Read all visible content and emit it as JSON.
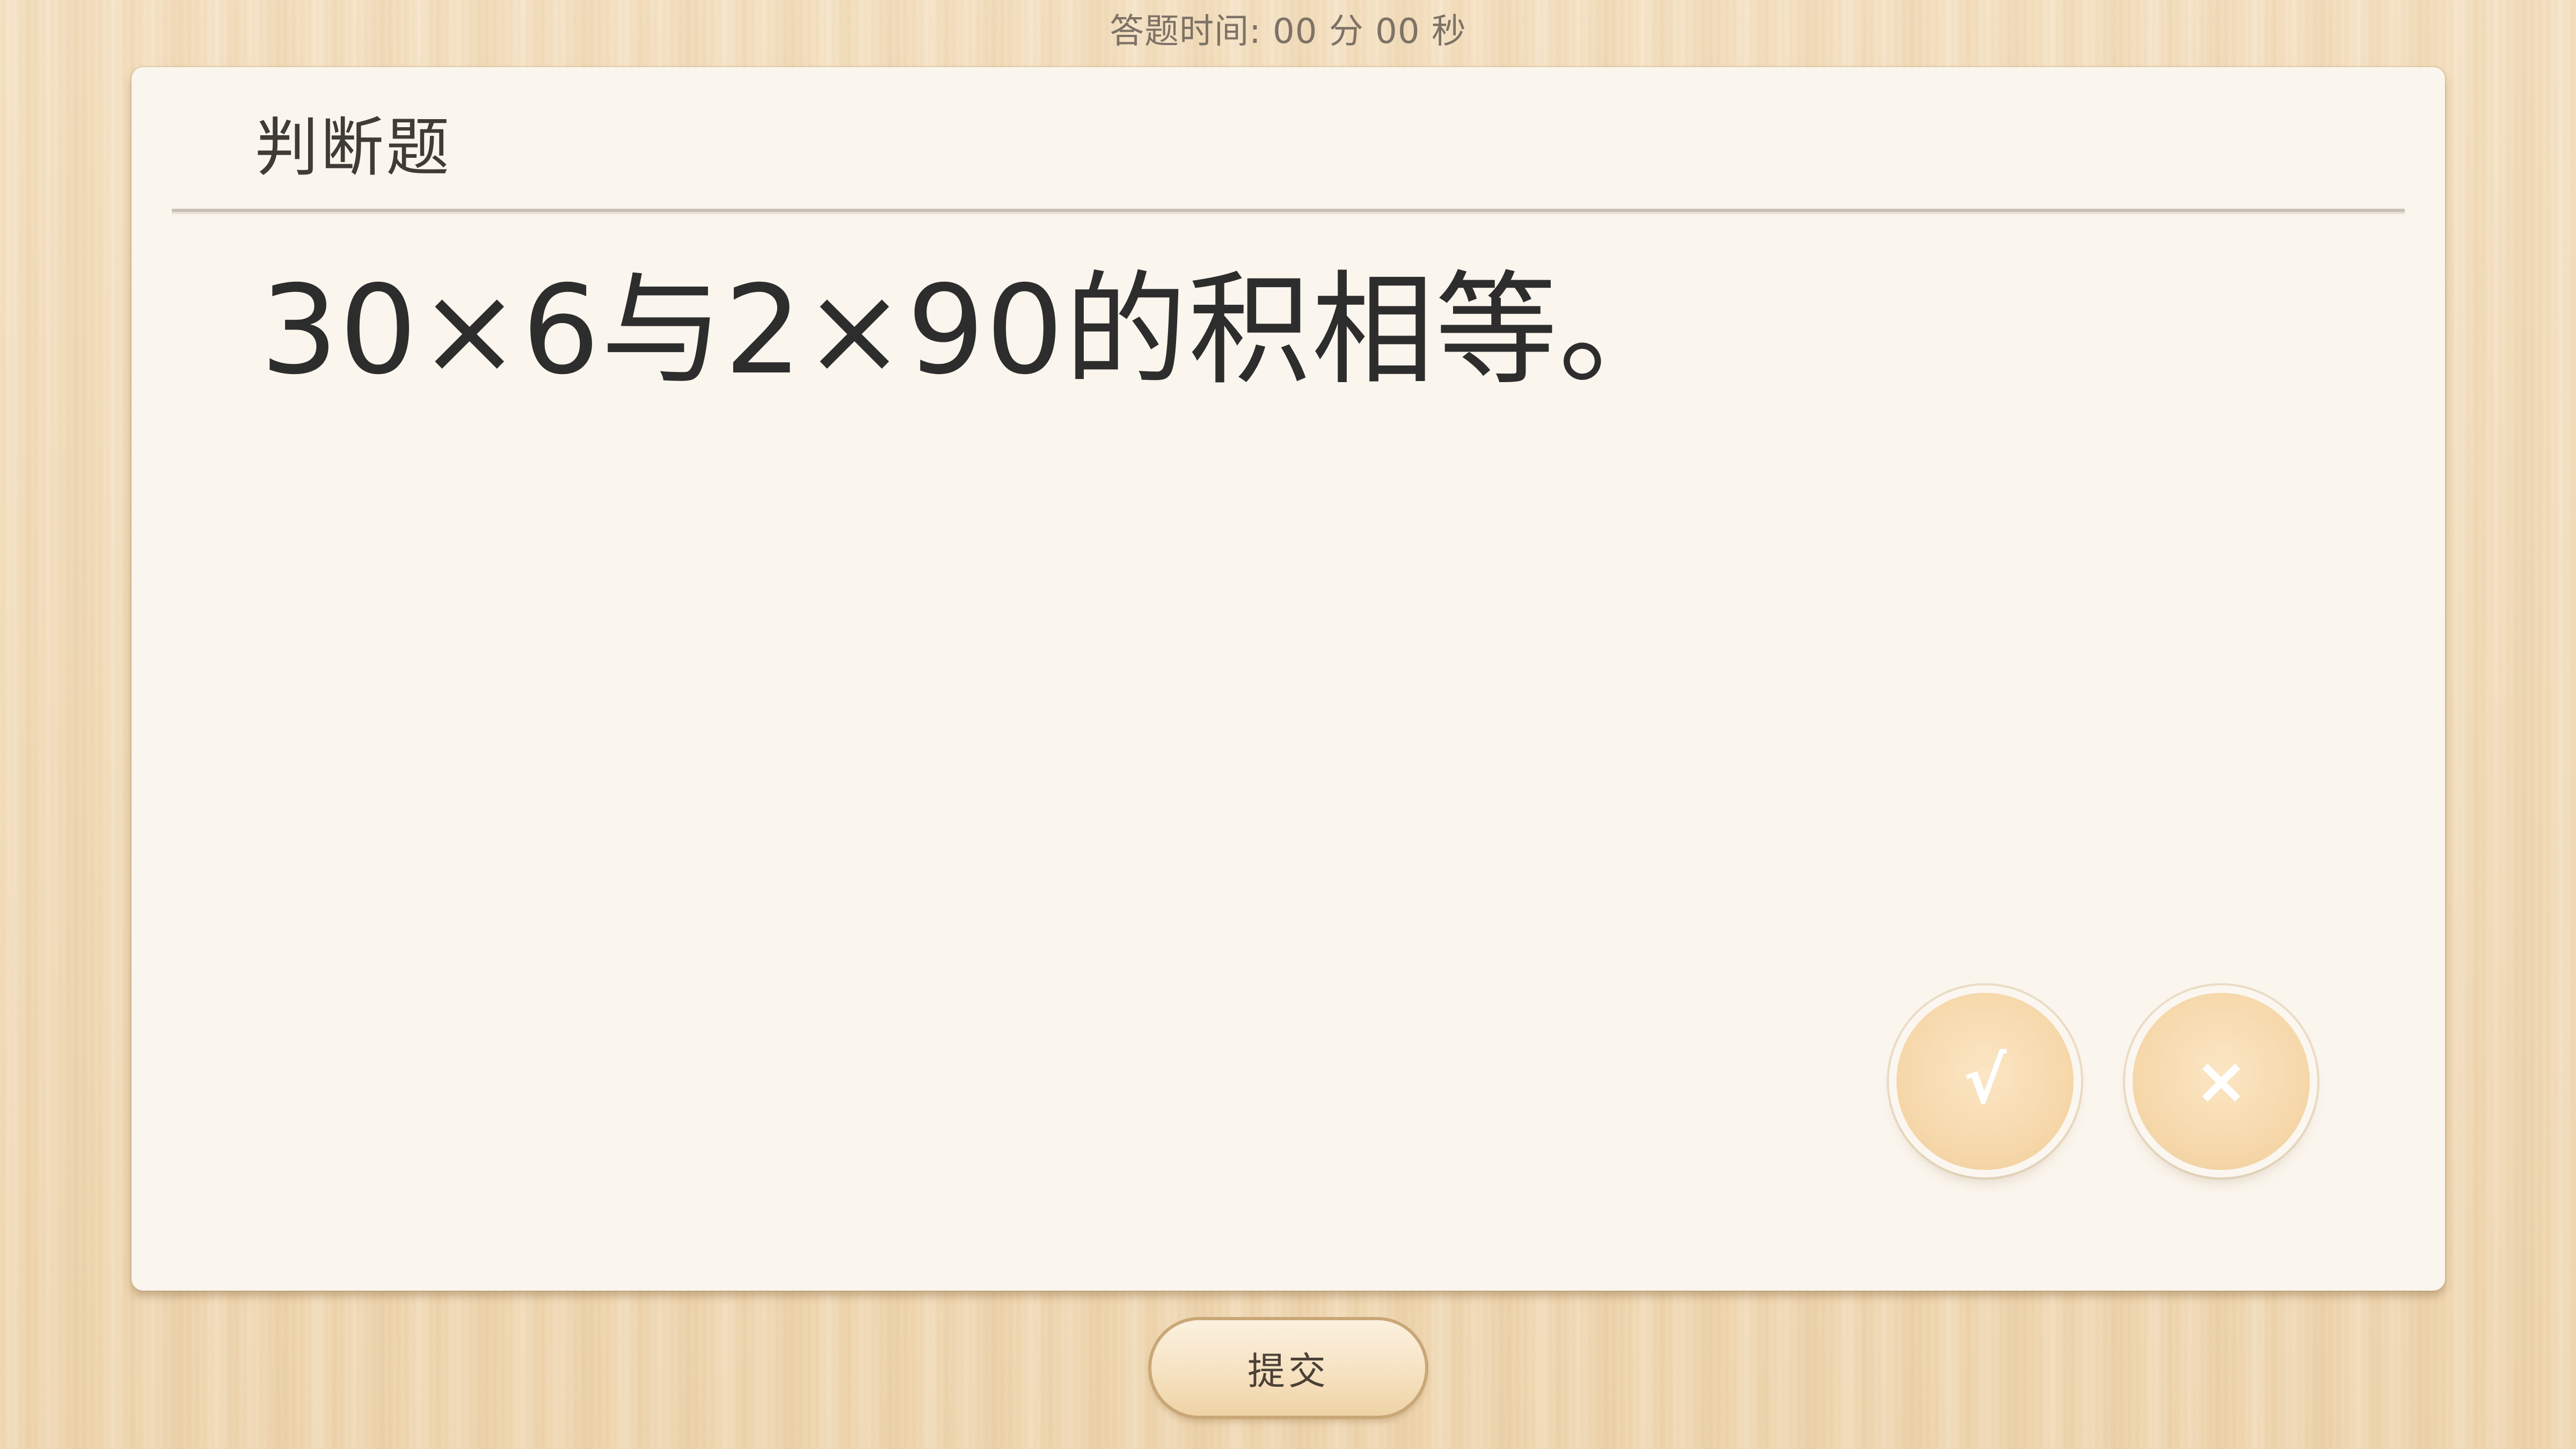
{
  "timer": {
    "label": "答题时间:",
    "minutes": "00",
    "minutes_unit": "分",
    "seconds": "00",
    "seconds_unit": "秒"
  },
  "question": {
    "type_label": "判断题",
    "text": "30×6与2×90的积相等。"
  },
  "answers": {
    "true_label": "√",
    "false_label": "×"
  },
  "submit_label": "提交",
  "colors": {
    "card_bg": "#faf5ed",
    "answer_button": "#f6d8ab",
    "submit_border": "#c9a776"
  }
}
